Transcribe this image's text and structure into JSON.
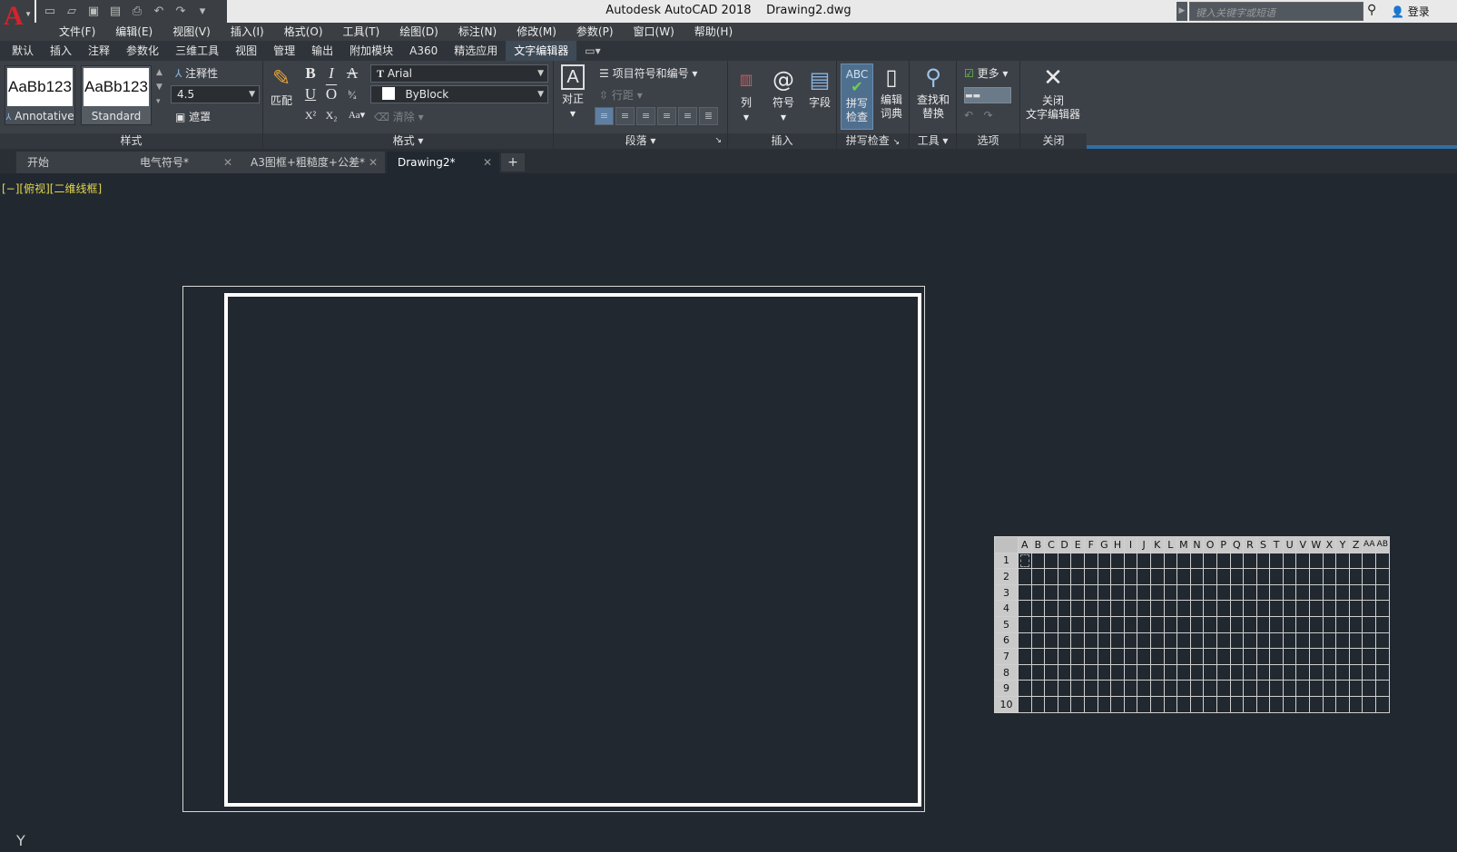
{
  "title_bar": {
    "app_title": "Autodesk AutoCAD 2018",
    "file_name": "Drawing2.dwg",
    "search_placeholder": "键入关键字或短语",
    "login_label": "登录",
    "logo_letter": "A"
  },
  "menu": [
    "文件(F)",
    "编辑(E)",
    "视图(V)",
    "插入(I)",
    "格式(O)",
    "工具(T)",
    "绘图(D)",
    "标注(N)",
    "修改(M)",
    "参数(P)",
    "窗口(W)",
    "帮助(H)"
  ],
  "ribbon_tabs": [
    "默认",
    "插入",
    "注释",
    "参数化",
    "三维工具",
    "视图",
    "管理",
    "输出",
    "附加模块",
    "A360",
    "精选应用",
    "文字编辑器"
  ],
  "ribbon_active_tab": "文字编辑器",
  "ribbon": {
    "style": {
      "title": "样式",
      "swatch1_preview": "AaBb123",
      "swatch1_name": "Annotative",
      "swatch2_preview": "AaBb123",
      "swatch2_name": "Standard",
      "annotative_label": "注释性",
      "height_value": "4.5",
      "mask_label": "遮罩"
    },
    "format": {
      "title": "格式",
      "match_label": "匹配",
      "font_value": "Arial",
      "color_value": "ByBlock",
      "clear_label": "清除"
    },
    "paragraph": {
      "title": "段落",
      "justify_label": "对正",
      "bullets_label": "项目符号和编号",
      "line_spacing_label": "行距"
    },
    "insert": {
      "title": "插入",
      "columns_label": "列",
      "symbol_label": "符号",
      "field_label": "字段"
    },
    "spell": {
      "title": "拼写检查",
      "spell_check_label_1": "拼写",
      "spell_check_label_2": "检查",
      "edit_dict_label_1": "编辑",
      "edit_dict_label_2": "词典"
    },
    "tools": {
      "title": "工具",
      "find_label_1": "查找和",
      "find_label_2": "替换"
    },
    "options": {
      "title": "选项",
      "more_label": "更多"
    },
    "close": {
      "title": "关闭",
      "close_label_1": "关闭",
      "close_label_2": "文字编辑器"
    }
  },
  "doc_tabs": [
    {
      "label": "开始"
    },
    {
      "label": "电气符号*"
    },
    {
      "label": "A3图框+粗糙度+公差*"
    },
    {
      "label": "Drawing2*"
    }
  ],
  "viewport_label": "[−][俯视][二维线框]",
  "ucs_label": "Y",
  "grid": {
    "columns": [
      "A",
      "B",
      "C",
      "D",
      "E",
      "F",
      "G",
      "H",
      "I",
      "J",
      "K",
      "L",
      "M",
      "N",
      "O",
      "P",
      "Q",
      "R",
      "S",
      "T",
      "U",
      "V",
      "W",
      "X",
      "Y",
      "Z",
      "AA",
      "AB"
    ],
    "rows": [
      "1",
      "2",
      "3",
      "4",
      "5",
      "6",
      "7",
      "8",
      "9",
      "10"
    ]
  }
}
